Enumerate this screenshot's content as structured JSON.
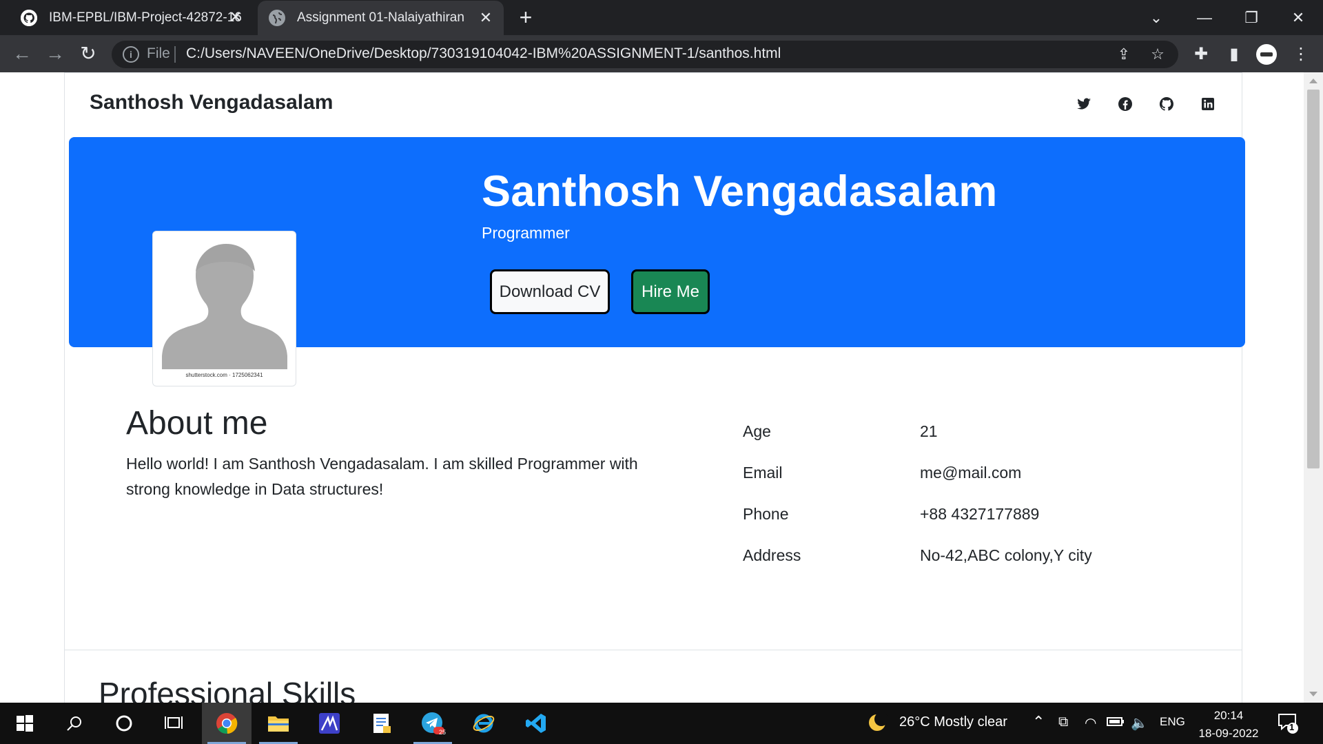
{
  "browser": {
    "tabs": [
      {
        "title": "IBM-EPBL/IBM-Project-42872-16",
        "icon": "github-icon",
        "active": false
      },
      {
        "title": "Assignment 01-Nalaiyathiran",
        "icon": "globe-icon",
        "active": true
      }
    ],
    "address": {
      "scheme_label": "File",
      "url": "C:/Users/NAVEEN/OneDrive/Desktop/730319104042-IBM%20ASSIGNMENT-1/santhos.html"
    }
  },
  "site": {
    "brand": "Santhosh Vengadasalam",
    "social": [
      "twitter-icon",
      "facebook-icon",
      "github-icon",
      "linkedin-icon"
    ]
  },
  "hero": {
    "name": "Santhosh Vengadasalam",
    "role": "Programmer",
    "download_label": "Download CV",
    "hire_label": "Hire Me",
    "avatar_caption": "shutterstock.com · 1725062341",
    "colors": {
      "hero_bg": "#0d6efd",
      "hire_bg": "#198754"
    }
  },
  "about": {
    "title": "About me",
    "text": "Hello world! I am Santhosh Vengadasalam. I am skilled Programmer with strong knowledge in Data structures!",
    "details": [
      {
        "label": "Age",
        "value": "21"
      },
      {
        "label": "Email",
        "value": "me@mail.com"
      },
      {
        "label": "Phone",
        "value": "+88 4327177889"
      },
      {
        "label": "Address",
        "value": "No-42,ABC colony,Y city"
      }
    ]
  },
  "skills": {
    "title": "Professional Skills"
  },
  "taskbar": {
    "weather": "26°C  Mostly clear",
    "language": "ENG",
    "time": "20:14",
    "date": "18-09-2022",
    "notifications": "1",
    "telegram_badge": "25"
  }
}
